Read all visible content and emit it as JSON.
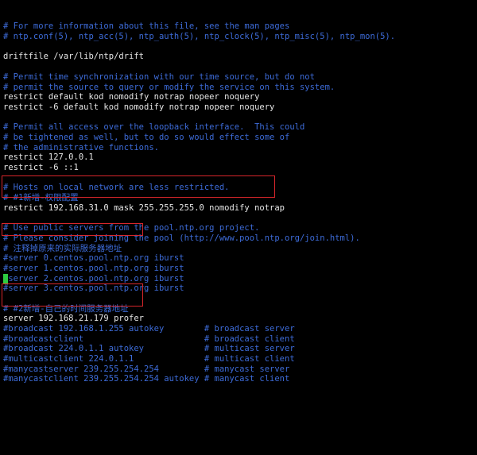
{
  "terminal": {
    "lines": [
      {
        "text": "# For more information about this file, see the man pages",
        "kind": "comment"
      },
      {
        "text": "# ntp.conf(5), ntp_acc(5), ntp_auth(5), ntp_clock(5), ntp_misc(5), ntp_mon(5).",
        "kind": "comment"
      },
      {
        "text": "",
        "kind": "text"
      },
      {
        "text": "driftfile /var/lib/ntp/drift",
        "kind": "text"
      },
      {
        "text": "",
        "kind": "text"
      },
      {
        "text": "# Permit time synchronization with our time source, but do not",
        "kind": "comment"
      },
      {
        "text": "# permit the source to query or modify the service on this system.",
        "kind": "comment"
      },
      {
        "text": "restrict default kod nomodify notrap nopeer noquery",
        "kind": "text"
      },
      {
        "text": "restrict -6 default kod nomodify notrap nopeer noquery",
        "kind": "text"
      },
      {
        "text": "",
        "kind": "text"
      },
      {
        "text": "# Permit all access over the loopback interface.  This could",
        "kind": "comment"
      },
      {
        "text": "# be tightened as well, but to do so would effect some of",
        "kind": "comment"
      },
      {
        "text": "# the administrative functions.",
        "kind": "comment"
      },
      {
        "text": "restrict 127.0.0.1",
        "kind": "text"
      },
      {
        "text": "restrict -6 ::1",
        "kind": "text"
      },
      {
        "text": "",
        "kind": "text"
      },
      {
        "text": "# Hosts on local network are less restricted.",
        "kind": "comment"
      },
      {
        "text": "# #1新增-权限配置",
        "kind": "comment"
      },
      {
        "text": "restrict 192.168.31.0 mask 255.255.255.0 nomodify notrap",
        "kind": "text"
      },
      {
        "text": "",
        "kind": "text"
      },
      {
        "text": "# Use public servers from the pool.ntp.org project.",
        "kind": "comment"
      },
      {
        "text": "# Please consider joining the pool (http://www.pool.ntp.org/join.html).",
        "kind": "comment"
      },
      {
        "text": "# 注释掉原来的实际服务器地址",
        "kind": "comment"
      },
      {
        "text": "#server 0.centos.pool.ntp.org iburst",
        "kind": "comment"
      },
      {
        "text": "#server 1.centos.pool.ntp.org iburst",
        "kind": "comment"
      },
      {
        "text": "#server 2.centos.pool.ntp.org iburst",
        "kind": "comment"
      },
      {
        "text": "#server 3.centos.pool.ntp.org iburst",
        "kind": "comment"
      },
      {
        "text": "",
        "kind": "text"
      },
      {
        "text": "# #2新增-自己的时间服务器地址",
        "kind": "comment"
      },
      {
        "text": "server 192.168.21.179 profer",
        "kind": "text"
      },
      {
        "text": "#broadcast 192.168.1.255 autokey        # broadcast server",
        "kind": "comment"
      },
      {
        "text": "#broadcastclient                        # broadcast client",
        "kind": "comment"
      },
      {
        "text": "#broadcast 224.0.1.1 autokey            # multicast server",
        "kind": "comment"
      },
      {
        "text": "#multicastclient 224.0.1.1              # multicast client",
        "kind": "comment"
      },
      {
        "text": "#manycastserver 239.255.254.254         # manycast server",
        "kind": "comment"
      },
      {
        "text": "#manycastclient 239.255.254.254 autokey # manycast client",
        "kind": "comment"
      }
    ]
  },
  "colors": {
    "background": "#000000",
    "comment": "#3d6bd8",
    "text": "#e6e6e6",
    "highlight_box": "#d8262b",
    "cursor": "#2ecc40"
  }
}
